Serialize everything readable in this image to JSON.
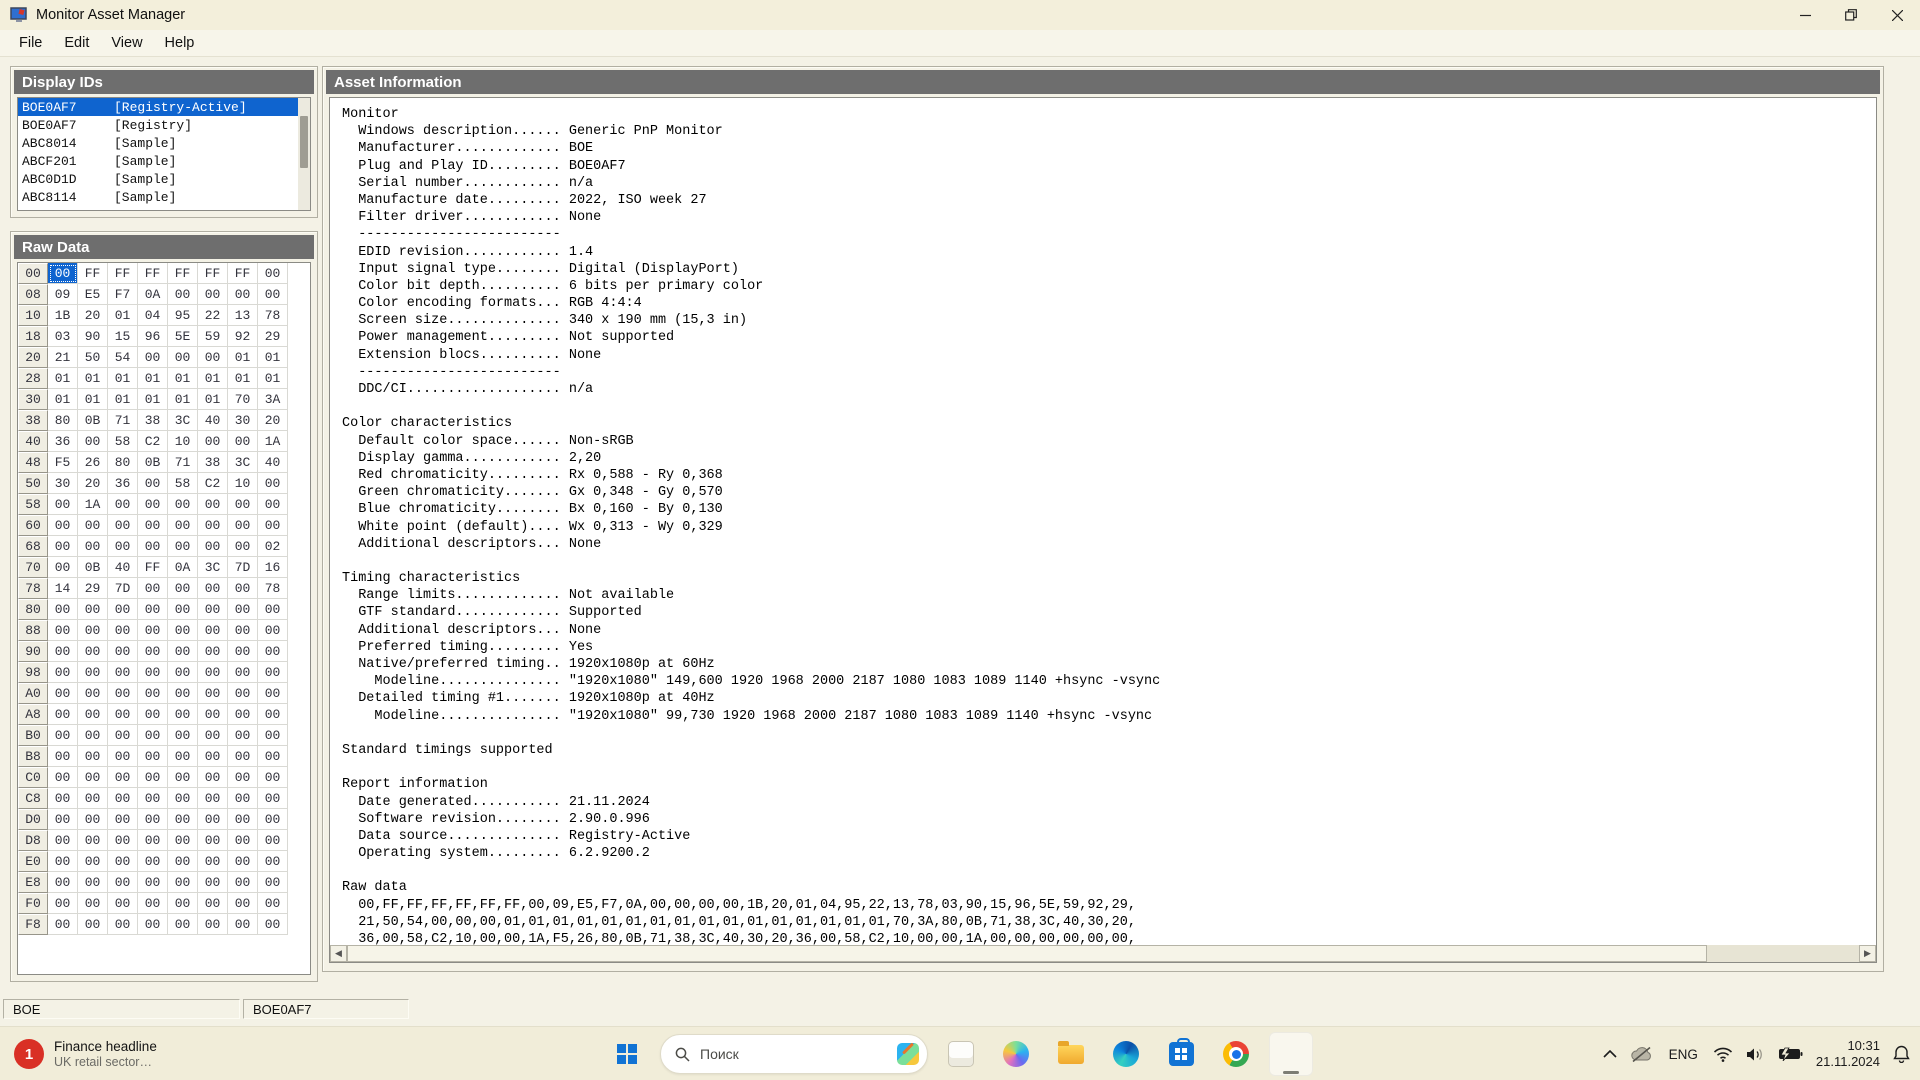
{
  "window": {
    "title": "Monitor Asset Manager"
  },
  "menu": {
    "items": [
      "File",
      "Edit",
      "View",
      "Help"
    ]
  },
  "panels": {
    "display_ids": {
      "title": "Display IDs",
      "items": [
        {
          "id": "BOE0AF7",
          "tag": "[Registry-Active]",
          "selected": true
        },
        {
          "id": "BOE0AF7",
          "tag": "[Registry]",
          "selected": false
        },
        {
          "id": "ABC8014",
          "tag": "[Sample]",
          "selected": false
        },
        {
          "id": "ABCF201",
          "tag": "[Sample]",
          "selected": false
        },
        {
          "id": "ABC0D1D",
          "tag": "[Sample]",
          "selected": false
        },
        {
          "id": "ABC8114",
          "tag": "[Sample]",
          "selected": false
        }
      ]
    },
    "raw_data": {
      "title": "Raw Data",
      "selected": {
        "row": 0,
        "col": 0
      },
      "row_labels": [
        "00",
        "08",
        "10",
        "18",
        "20",
        "28",
        "30",
        "38",
        "40",
        "48",
        "50",
        "58",
        "60",
        "68",
        "70",
        "78",
        "80",
        "88",
        "90",
        "98",
        "A0",
        "A8",
        "B0",
        "B8",
        "C0",
        "C8",
        "D0",
        "D8",
        "E0",
        "E8",
        "F0",
        "F8"
      ],
      "rows": [
        [
          "00",
          "FF",
          "FF",
          "FF",
          "FF",
          "FF",
          "FF",
          "00"
        ],
        [
          "09",
          "E5",
          "F7",
          "0A",
          "00",
          "00",
          "00",
          "00"
        ],
        [
          "1B",
          "20",
          "01",
          "04",
          "95",
          "22",
          "13",
          "78"
        ],
        [
          "03",
          "90",
          "15",
          "96",
          "5E",
          "59",
          "92",
          "29"
        ],
        [
          "21",
          "50",
          "54",
          "00",
          "00",
          "00",
          "01",
          "01"
        ],
        [
          "01",
          "01",
          "01",
          "01",
          "01",
          "01",
          "01",
          "01"
        ],
        [
          "01",
          "01",
          "01",
          "01",
          "01",
          "01",
          "70",
          "3A"
        ],
        [
          "80",
          "0B",
          "71",
          "38",
          "3C",
          "40",
          "30",
          "20"
        ],
        [
          "36",
          "00",
          "58",
          "C2",
          "10",
          "00",
          "00",
          "1A"
        ],
        [
          "F5",
          "26",
          "80",
          "0B",
          "71",
          "38",
          "3C",
          "40"
        ],
        [
          "30",
          "20",
          "36",
          "00",
          "58",
          "C2",
          "10",
          "00"
        ],
        [
          "00",
          "1A",
          "00",
          "00",
          "00",
          "00",
          "00",
          "00"
        ],
        [
          "00",
          "00",
          "00",
          "00",
          "00",
          "00",
          "00",
          "00"
        ],
        [
          "00",
          "00",
          "00",
          "00",
          "00",
          "00",
          "00",
          "02"
        ],
        [
          "00",
          "0B",
          "40",
          "FF",
          "0A",
          "3C",
          "7D",
          "16"
        ],
        [
          "14",
          "29",
          "7D",
          "00",
          "00",
          "00",
          "00",
          "78"
        ],
        [
          "00",
          "00",
          "00",
          "00",
          "00",
          "00",
          "00",
          "00"
        ],
        [
          "00",
          "00",
          "00",
          "00",
          "00",
          "00",
          "00",
          "00"
        ],
        [
          "00",
          "00",
          "00",
          "00",
          "00",
          "00",
          "00",
          "00"
        ],
        [
          "00",
          "00",
          "00",
          "00",
          "00",
          "00",
          "00",
          "00"
        ],
        [
          "00",
          "00",
          "00",
          "00",
          "00",
          "00",
          "00",
          "00"
        ],
        [
          "00",
          "00",
          "00",
          "00",
          "00",
          "00",
          "00",
          "00"
        ],
        [
          "00",
          "00",
          "00",
          "00",
          "00",
          "00",
          "00",
          "00"
        ],
        [
          "00",
          "00",
          "00",
          "00",
          "00",
          "00",
          "00",
          "00"
        ],
        [
          "00",
          "00",
          "00",
          "00",
          "00",
          "00",
          "00",
          "00"
        ],
        [
          "00",
          "00",
          "00",
          "00",
          "00",
          "00",
          "00",
          "00"
        ],
        [
          "00",
          "00",
          "00",
          "00",
          "00",
          "00",
          "00",
          "00"
        ],
        [
          "00",
          "00",
          "00",
          "00",
          "00",
          "00",
          "00",
          "00"
        ],
        [
          "00",
          "00",
          "00",
          "00",
          "00",
          "00",
          "00",
          "00"
        ],
        [
          "00",
          "00",
          "00",
          "00",
          "00",
          "00",
          "00",
          "00"
        ],
        [
          "00",
          "00",
          "00",
          "00",
          "00",
          "00",
          "00",
          "00"
        ],
        [
          "00",
          "00",
          "00",
          "00",
          "00",
          "00",
          "00",
          "00"
        ]
      ]
    },
    "asset": {
      "title": "Asset Information",
      "lines": [
        "Monitor",
        "  Windows description...... Generic PnP Monitor",
        "  Manufacturer............. BOE",
        "  Plug and Play ID......... BOE0AF7",
        "  Serial number............ n/a",
        "  Manufacture date......... 2022, ISO week 27",
        "  Filter driver............ None",
        "  -------------------------",
        "  EDID revision............ 1.4",
        "  Input signal type........ Digital (DisplayPort)",
        "  Color bit depth.......... 6 bits per primary color",
        "  Color encoding formats... RGB 4:4:4",
        "  Screen size.............. 340 x 190 mm (15,3 in)",
        "  Power management......... Not supported",
        "  Extension blocs.......... None",
        "  -------------------------",
        "  DDC/CI................... n/a",
        "",
        "Color characteristics",
        "  Default color space...... Non-sRGB",
        "  Display gamma............ 2,20",
        "  Red chromaticity......... Rx 0,588 - Ry 0,368",
        "  Green chromaticity....... Gx 0,348 - Gy 0,570",
        "  Blue chromaticity........ Bx 0,160 - By 0,130",
        "  White point (default).... Wx 0,313 - Wy 0,329",
        "  Additional descriptors... None",
        "",
        "Timing characteristics",
        "  Range limits............. Not available",
        "  GTF standard............. Supported",
        "  Additional descriptors... None",
        "  Preferred timing......... Yes",
        "  Native/preferred timing.. 1920x1080p at 60Hz",
        "    Modeline............... \"1920x1080\" 149,600 1920 1968 2000 2187 1080 1083 1089 1140 +hsync -vsync",
        "  Detailed timing #1....... 1920x1080p at 40Hz",
        "    Modeline............... \"1920x1080\" 99,730 1920 1968 2000 2187 1080 1083 1089 1140 +hsync -vsync",
        "",
        "Standard timings supported",
        "",
        "Report information",
        "  Date generated........... 21.11.2024",
        "  Software revision........ 2.90.0.996",
        "  Data source.............. Registry-Active",
        "  Operating system......... 6.2.9200.2",
        "",
        "Raw data",
        "  00,FF,FF,FF,FF,FF,FF,00,09,E5,F7,0A,00,00,00,00,1B,20,01,04,95,22,13,78,03,90,15,96,5E,59,92,29,",
        "  21,50,54,00,00,00,01,01,01,01,01,01,01,01,01,01,01,01,01,01,01,01,70,3A,80,0B,71,38,3C,40,30,20,",
        "  36,00,58,C2,10,00,00,1A,F5,26,80,0B,71,38,3C,40,30,20,36,00,58,C2,10,00,00,1A,00,00,00,00,00,00,"
      ]
    }
  },
  "statusbar": {
    "left": "BOE",
    "middle": "BOE0AF7"
  },
  "taskbar": {
    "notification": {
      "badge": "1",
      "title": "Finance headline",
      "subtitle": "UK retail sector…"
    },
    "search": {
      "placeholder": "Поиск"
    },
    "apps": [
      {
        "name": "app-window",
        "active": false
      },
      {
        "name": "copilot",
        "active": false
      },
      {
        "name": "file-explorer",
        "active": false
      },
      {
        "name": "edge",
        "active": false
      },
      {
        "name": "store",
        "active": false
      },
      {
        "name": "chrome",
        "active": false
      },
      {
        "name": "monitor-asset-manager",
        "active": true
      }
    ],
    "tray": {
      "language": "ENG",
      "time": "10:31",
      "date": "21.11.2024"
    }
  },
  "colors": {
    "selection_blue": "#0f64cf",
    "group_header_gray": "#6e6e6e",
    "titlebar_beige": "#f3efdb",
    "taskbar_beige": "#f1edd9",
    "notification_red": "#d93025"
  }
}
